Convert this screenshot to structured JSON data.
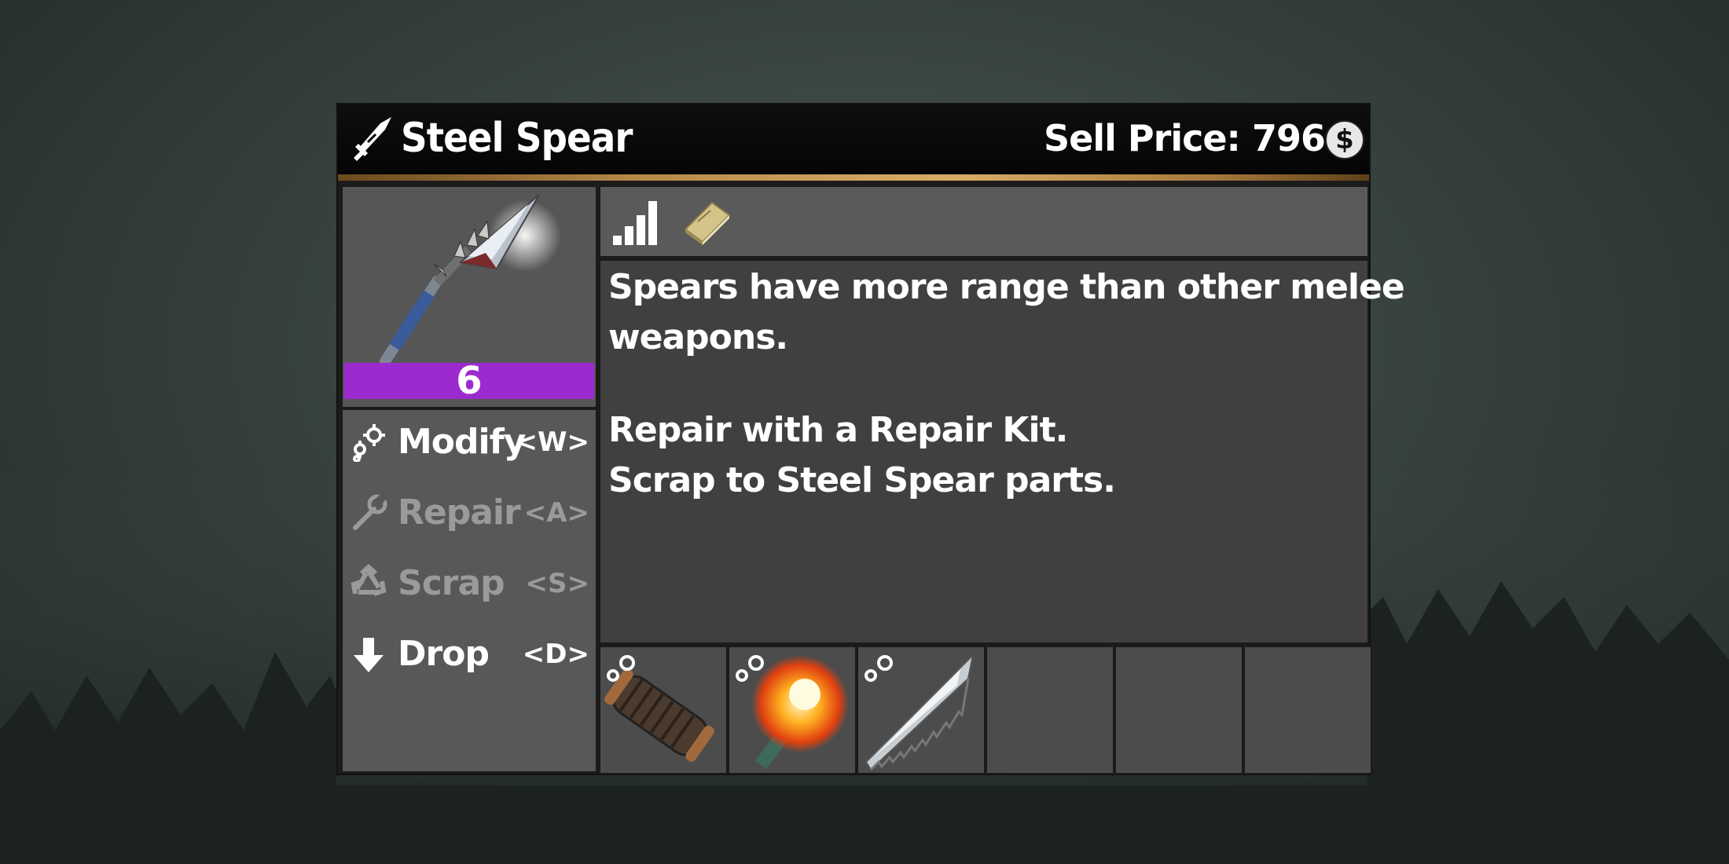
{
  "item": {
    "name": "Steel Spear",
    "sell_label": "Sell Price: 796",
    "currency_symbol": "$",
    "quality": "6",
    "quality_color": "#9c2bcf"
  },
  "actions": [
    {
      "label": "Modify",
      "key": "<W>",
      "icon": "modify-gears-icon",
      "enabled": true
    },
    {
      "label": "Repair",
      "key": "<A>",
      "icon": "wrench-icon",
      "enabled": false
    },
    {
      "label": "Scrap",
      "key": "<S>",
      "icon": "recycle-icon",
      "enabled": false
    },
    {
      "label": "Drop",
      "key": "<D>",
      "icon": "arrow-down-icon",
      "enabled": true
    }
  ],
  "stats_icons": [
    "signal-bars-icon",
    "book-icon"
  ],
  "description": {
    "lines": [
      "Spears have more range than other melee",
      "weapons.",
      "",
      "Repair with a Repair Kit.",
      "Scrap to Steel Spear parts."
    ]
  },
  "mod_slots": [
    {
      "icon": "grip-mod-icon",
      "filled": true
    },
    {
      "icon": "burning-shaft-mod-icon",
      "filled": true
    },
    {
      "icon": "serrated-blade-mod-icon",
      "filled": true
    },
    {
      "icon": "",
      "filled": false
    },
    {
      "icon": "",
      "filled": false
    },
    {
      "icon": "",
      "filled": false
    }
  ]
}
